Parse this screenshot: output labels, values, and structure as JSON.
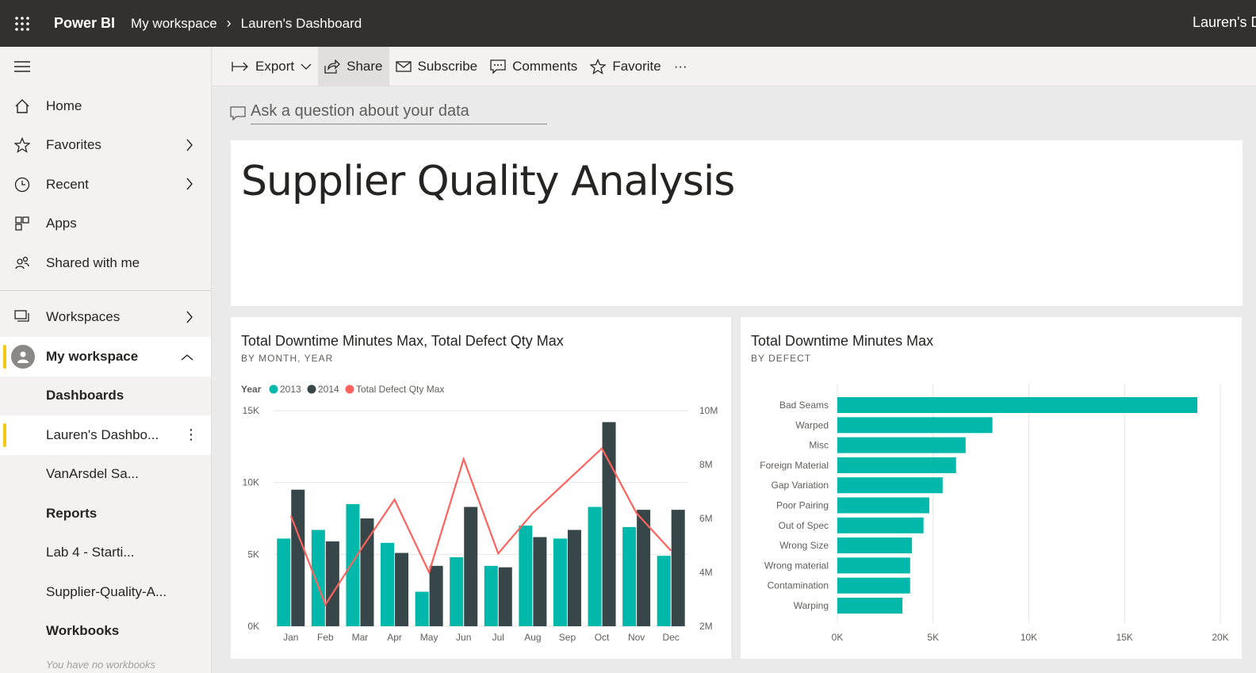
{
  "topbar": {
    "brand": "Power BI",
    "breadcrumb": [
      "My workspace",
      "Lauren's Dashboard"
    ],
    "user": "Lauren's D"
  },
  "sidebar": {
    "items": [
      {
        "label": "Home",
        "icon": "home-icon"
      },
      {
        "label": "Favorites",
        "icon": "star-icon"
      },
      {
        "label": "Recent",
        "icon": "clock-icon"
      },
      {
        "label": "Apps",
        "icon": "apps-icon"
      },
      {
        "label": "Shared with me",
        "icon": "shared-icon"
      }
    ],
    "workspaces_label": "Workspaces",
    "my_workspace_label": "My workspace",
    "sections": {
      "dashboards": "Dashboards",
      "dashboard_items": [
        "Lauren's Dashbo...",
        "VanArsdel Sa..."
      ],
      "reports": "Reports",
      "report_items": [
        "Lab 4 - Starti...",
        "Supplier-Quality-A..."
      ],
      "workbooks": "Workbooks",
      "no_workbooks": "You have no workbooks"
    }
  },
  "actionbar": {
    "export": "Export",
    "share": "Share",
    "subscribe": "Subscribe",
    "comments": "Comments",
    "favorite": "Favorite",
    "more": "···"
  },
  "qa": {
    "placeholder": "Ask a question about your data"
  },
  "dashboard_title": "Supplier Quality Analysis",
  "accent_teal": "#01b8aa",
  "accent_dark": "#374649",
  "accent_red": "#fd625e",
  "chart_data": [
    {
      "type": "bar",
      "title": "Total Downtime Minutes Max, Total Defect Qty Max",
      "subtitle": "BY MONTH, YEAR",
      "legend_title": "Year",
      "categories": [
        "Jan",
        "Feb",
        "Mar",
        "Apr",
        "May",
        "Jun",
        "Jul",
        "Aug",
        "Sep",
        "Oct",
        "Nov",
        "Dec"
      ],
      "series": [
        {
          "name": "2013",
          "kind": "bar",
          "values": [
            6100,
            6700,
            8500,
            5800,
            2400,
            4800,
            4200,
            7000,
            6100,
            8300,
            6900,
            4900
          ]
        },
        {
          "name": "2014",
          "kind": "bar",
          "values": [
            9500,
            5900,
            7500,
            5100,
            4200,
            8300,
            4100,
            6200,
            6700,
            14200,
            8100,
            8100
          ]
        },
        {
          "name": "Total Defect Qty Max",
          "kind": "line",
          "axis": "right",
          "values": [
            6100000,
            2800000,
            4800000,
            6700000,
            4000000,
            8200000,
            4700000,
            6200000,
            7400000,
            8600000,
            6200000,
            4800000
          ]
        }
      ],
      "ylim": [
        0,
        15000
      ],
      "yticks": [
        "0K",
        "5K",
        "10K",
        "15K"
      ],
      "ylim_right": [
        2000000,
        10000000
      ],
      "yticks_right": [
        "2M",
        "4M",
        "6M",
        "8M",
        "10M"
      ],
      "legend_position": "top-left"
    },
    {
      "type": "bar",
      "orientation": "horizontal",
      "title": "Total Downtime Minutes Max",
      "subtitle": "BY DEFECT",
      "categories": [
        "Bad Seams",
        "Warped",
        "Misc",
        "Foreign Material",
        "Gap Variation",
        "Poor Pairing",
        "Out of Spec",
        "Wrong Size",
        "Wrong material",
        "Contamination",
        "Warping"
      ],
      "values": [
        18800,
        8100,
        6700,
        6200,
        5500,
        4800,
        4500,
        3900,
        3800,
        3800,
        3400
      ],
      "xlim": [
        0,
        20000
      ],
      "xticks": [
        "0K",
        "5K",
        "10K",
        "15K",
        "20K"
      ],
      "grid": true
    }
  ]
}
